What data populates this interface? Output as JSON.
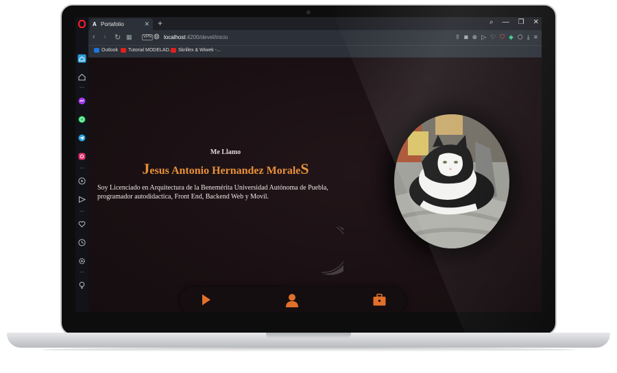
{
  "browser": {
    "tab_title": "Portafolio",
    "tab_favicon": "A",
    "new_tab": "+",
    "url_host": "localhost",
    "url_path": ":4200/devel/inicio",
    "vpn_label": "VPN",
    "bookmarks": [
      {
        "label": "Outlook",
        "icon": "outlook-icon",
        "color": "#1e74d8"
      },
      {
        "label": "Tutorial MODELAD...",
        "icon": "youtube-icon",
        "color": "#e02020"
      },
      {
        "label": "Skrillex & Wiwek -...",
        "icon": "youtube-icon",
        "color": "#e02020"
      }
    ]
  },
  "hero": {
    "greeting": "Me Llamo",
    "name_first_letter": "J",
    "name_middle": "esus Antonio Hernandez Morale",
    "name_last_letter": "S",
    "bio": "Soy Licenciado en Arquitectura de la Benemérita Universidad Autónoma de Puebla, programador autodidactica, Front End, Backend Web y Movil."
  },
  "photo": {
    "subject": "black and white cat"
  },
  "bottom_nav": [
    {
      "icon": "play-icon"
    },
    {
      "icon": "user-icon"
    },
    {
      "icon": "briefcase-icon"
    }
  ],
  "colors": {
    "accent": "#e8913a",
    "nav_icon": "#e0702a",
    "page_bg": "#1a1014",
    "browser_chrome": "#2c3038"
  }
}
